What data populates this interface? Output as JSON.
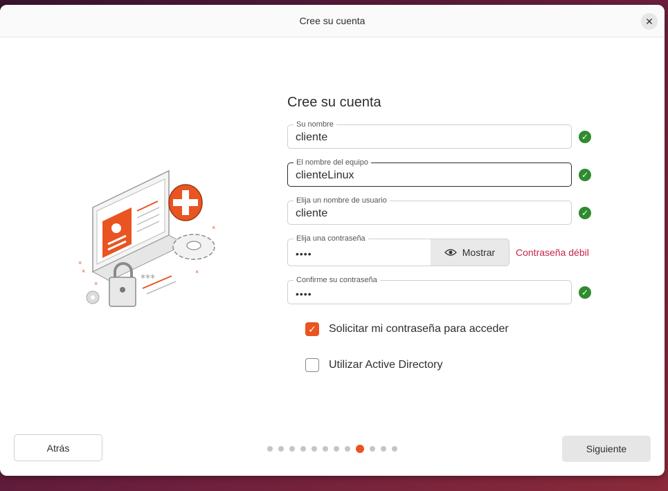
{
  "window": {
    "title": "Cree su cuenta"
  },
  "form": {
    "heading": "Cree su cuenta",
    "fields": [
      {
        "label": "Su nombre",
        "value": "cliente",
        "valid": true
      },
      {
        "label": "El nombre del equipo",
        "value": "clienteLinux",
        "valid": true
      },
      {
        "label": "Elija un nombre de usuario",
        "value": "cliente",
        "valid": true
      },
      {
        "label": "Elija una contraseña",
        "value": "••••",
        "strength": "Contraseña débil"
      },
      {
        "label": "Confirme su contraseña",
        "value": "••••",
        "valid": true
      }
    ],
    "show_password_label": "Mostrar",
    "check_glyph": "✓",
    "options": [
      {
        "label": "Solicitar mi contraseña para acceder",
        "checked": true
      },
      {
        "label": "Utilizar Active Directory",
        "checked": false
      }
    ]
  },
  "footer": {
    "back_label": "Atrás",
    "next_label": "Siguiente",
    "steps_total": 12,
    "current_step": 9
  },
  "colors": {
    "accent": "#e95420",
    "valid": "#2e8b2e",
    "weak": "#c7254e"
  }
}
